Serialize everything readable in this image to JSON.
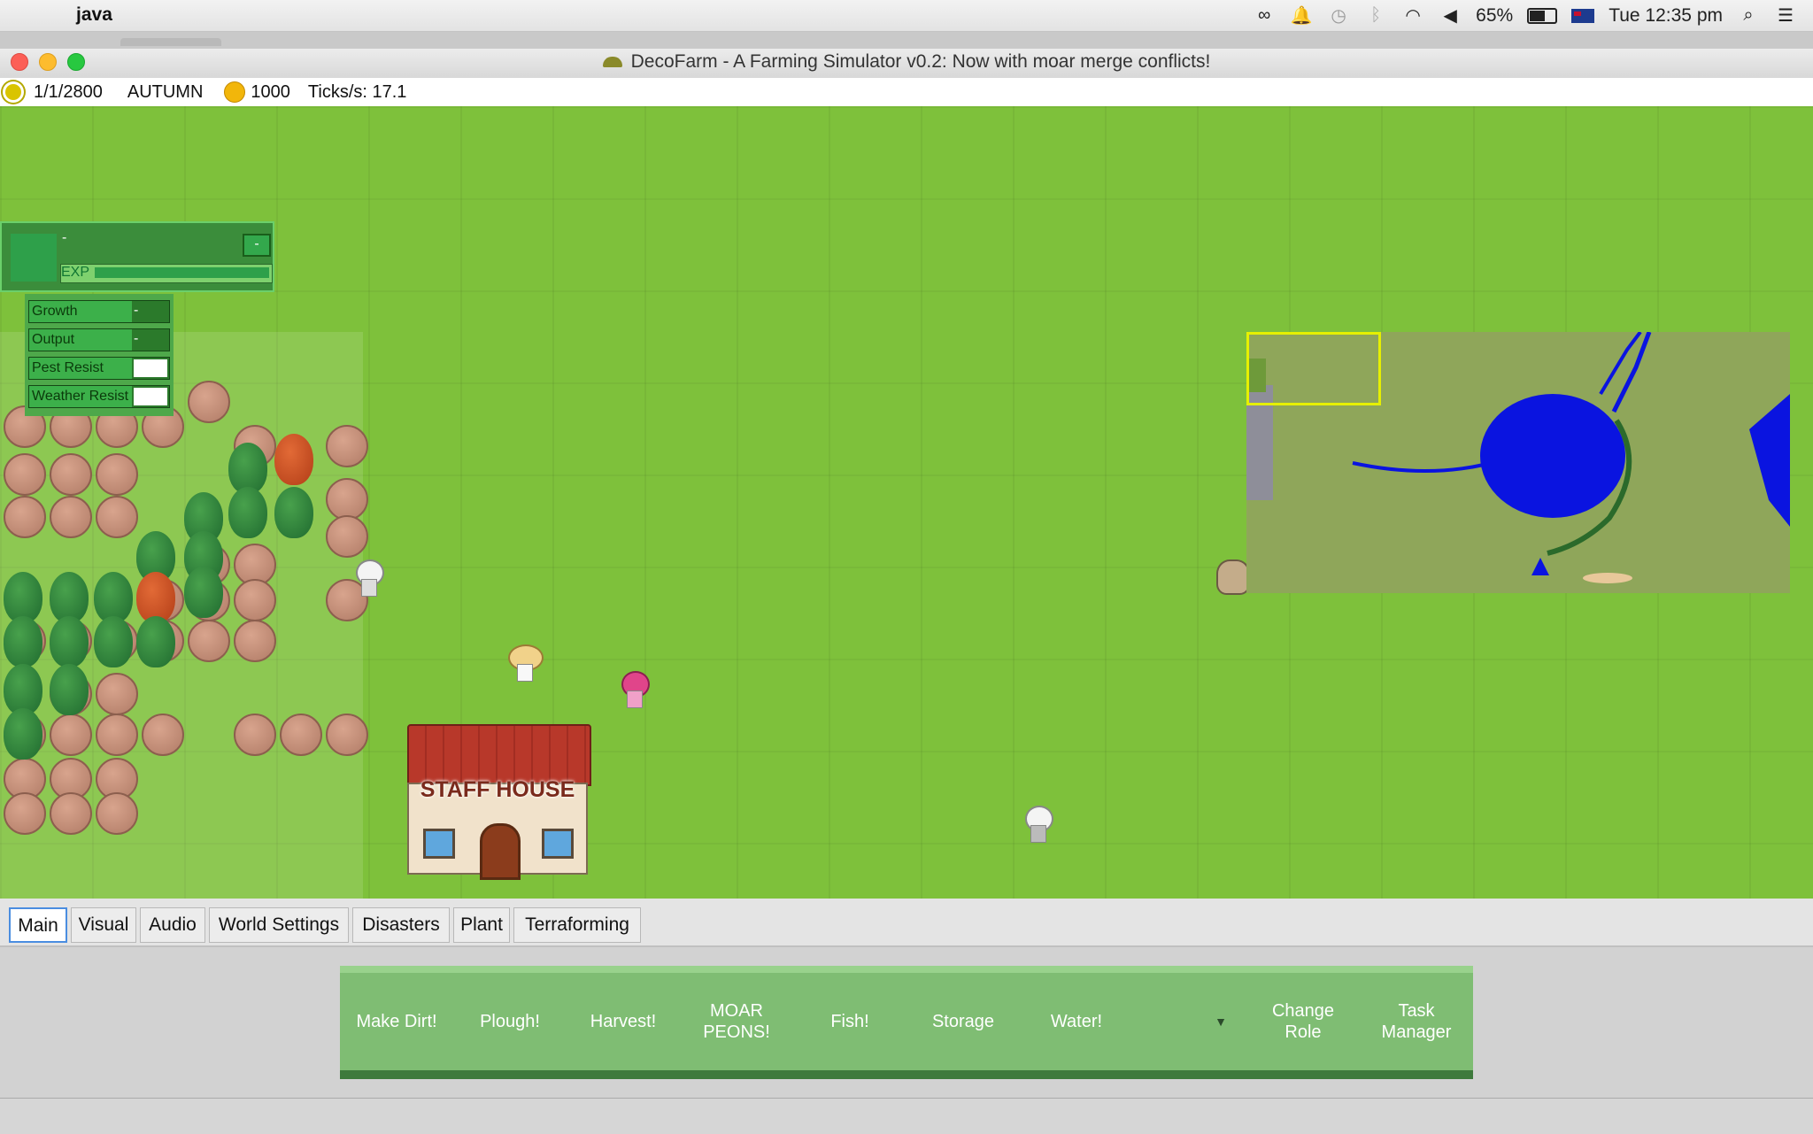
{
  "menubar": {
    "app_name": "java",
    "battery": "65%",
    "clock": "Tue 12:35 pm"
  },
  "window": {
    "title": "DecoFarm - A Farming Simulator v0.2: Now with moar merge conflicts!"
  },
  "status": {
    "date": "1/1/2800",
    "season": "AUTUMN",
    "coins": "1000",
    "ticks": "Ticks/s: 17.1"
  },
  "character_panel": {
    "name": "-",
    "collapse_label": "-",
    "exp_label": "EXP"
  },
  "stats": [
    {
      "label": "Growth",
      "value": "-"
    },
    {
      "label": "Output",
      "value": "-"
    },
    {
      "label": "Pest Resist",
      "value": ""
    },
    {
      "label": "Weather Resist",
      "value": ""
    }
  ],
  "building": {
    "sign": "STAFF HOUSE"
  },
  "tabs": [
    "Main",
    "Visual",
    "Audio",
    "World Settings",
    "Disasters",
    "Plant",
    "Terraforming"
  ],
  "active_tab": "Main",
  "toolbar": {
    "buttons": [
      "Make Dirt!",
      "Plough!",
      "Harvest!",
      "MOAR PEONS!",
      "Fish!",
      "Storage",
      "Water!"
    ],
    "dropdown_icon": "chevron-down-icon",
    "change_role": "Change Role",
    "task_manager": "Task Manager"
  },
  "colors": {
    "grass": "#7ec13b",
    "water": "#0a14e0",
    "minimap_viewport": "#e6f000",
    "toolbar": "#7fbd73",
    "active_tab_border": "#4a8de0"
  }
}
